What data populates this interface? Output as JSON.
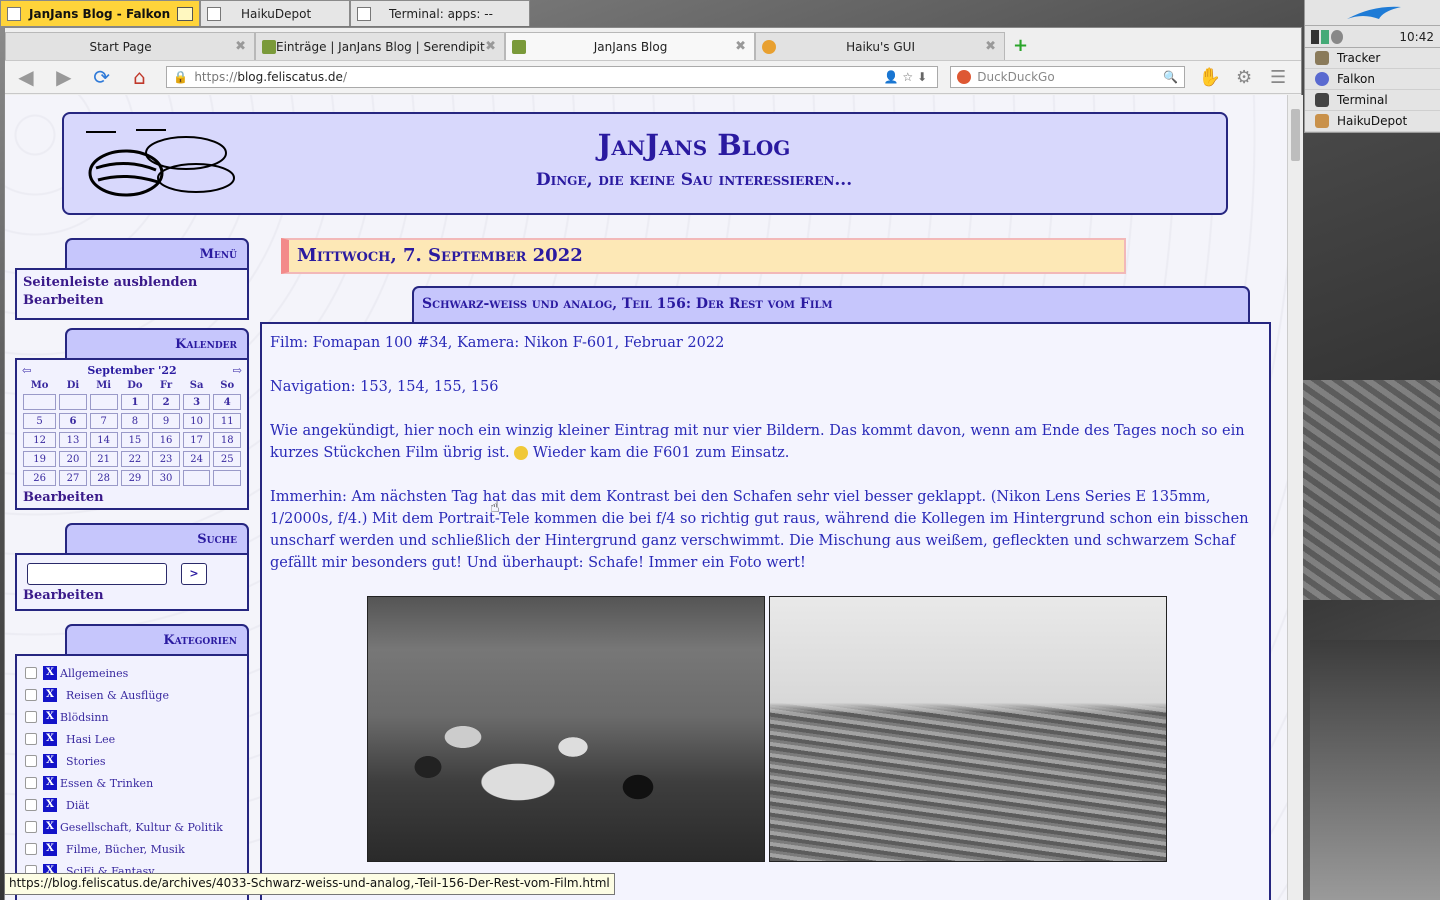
{
  "haiku_tabs": [
    {
      "label": "JanJans Blog - Falkon",
      "active": true
    },
    {
      "label": "HaikuDepot",
      "active": false
    },
    {
      "label": "Terminal: apps: --",
      "active": false
    }
  ],
  "deskbar": {
    "clock": "10:42",
    "apps": [
      "Tracker",
      "Falkon",
      "Terminal",
      "HaikuDepot"
    ]
  },
  "browser": {
    "tabs": [
      {
        "label": "Start Page",
        "icon": "page-icon"
      },
      {
        "label": "Einträge | JanJans Blog | Serendipit...",
        "icon": "bee-icon"
      },
      {
        "label": "JanJans Blog",
        "icon": "bee-icon",
        "selected": true
      },
      {
        "label": "Haiku's GUI",
        "icon": "haiku-icon"
      }
    ],
    "url_scheme": "https://",
    "url_host": "blog.feliscatus.de",
    "url_path": "/",
    "search_placeholder": "DuckDuckGo",
    "status_url": "https://blog.feliscatus.de/archives/4033-Schwarz-weiss-und-analog,-Teil-156-Der-Rest-vom-Film.html"
  },
  "blog": {
    "title": "JanJans Blog",
    "subtitle": "Dinge, die keine Sau interessieren...",
    "menu": {
      "title": "Menü",
      "links": [
        "Seitenleiste ausblenden",
        "Bearbeiten"
      ]
    },
    "calendar": {
      "title": "Kalender",
      "month": "September '22",
      "weekdays": [
        "Mo",
        "Di",
        "Mi",
        "Do",
        "Fr",
        "Sa",
        "So"
      ],
      "weeks": [
        [
          "",
          "",
          "",
          "1",
          "2",
          "3",
          "4"
        ],
        [
          "5",
          "6",
          "7",
          "8",
          "9",
          "10",
          "11"
        ],
        [
          "12",
          "13",
          "14",
          "15",
          "16",
          "17",
          "18"
        ],
        [
          "19",
          "20",
          "21",
          "22",
          "23",
          "24",
          "25"
        ],
        [
          "26",
          "27",
          "28",
          "29",
          "30",
          "",
          ""
        ]
      ],
      "edit": "Bearbeiten"
    },
    "search": {
      "title": "Suche",
      "button": ">",
      "edit": "Bearbeiten"
    },
    "categories": {
      "title": "Kategorien",
      "items": [
        "Allgemeines",
        "Reisen & Ausflüge",
        "Blödsinn",
        "Hasi Lee",
        "Stories",
        "Essen & Trinken",
        "Diät",
        "Gesellschaft, Kultur & Politik",
        "Filme, Bücher, Musik",
        "SciFi & Fantasy"
      ]
    },
    "date": "Mittwoch, 7. September 2022",
    "post": {
      "title": "Schwarz-weiß und analog, Teil 156: Der Rest vom Film",
      "film": "Film: Fomapan 100 #34, Kamera: Nikon F-601, Februar 2022",
      "nav": "Navigation: 153, 154, 155, 156",
      "para1a": "Wie angekündigt, hier noch ein winzig kleiner Eintrag mit nur vier Bildern. Das kommt davon, wenn am Ende des Tages noch so ein kurzes Stückchen Film übrig ist.",
      "para1b": "Wieder kam die F601 zum Einsatz.",
      "para2": "Immerhin: Am nächsten Tag hat das mit dem Kontrast bei den Schafen sehr viel besser geklappt. (Nikon Lens Series E 135mm, 1/2000s, f/4.) Mit dem Portrait-Tele kommen die bei f/4 so richtig gut raus, während die Kollegen im Hintergrund schon ein bisschen unscharf werden und schließlich der Hintergrund ganz verschwimmt. Die Mischung aus weißem, gefleckten und schwarzem Schaf gefällt mir besonders gut! Und überhaupt: Schafe! Immer ein Foto wert!"
    }
  }
}
